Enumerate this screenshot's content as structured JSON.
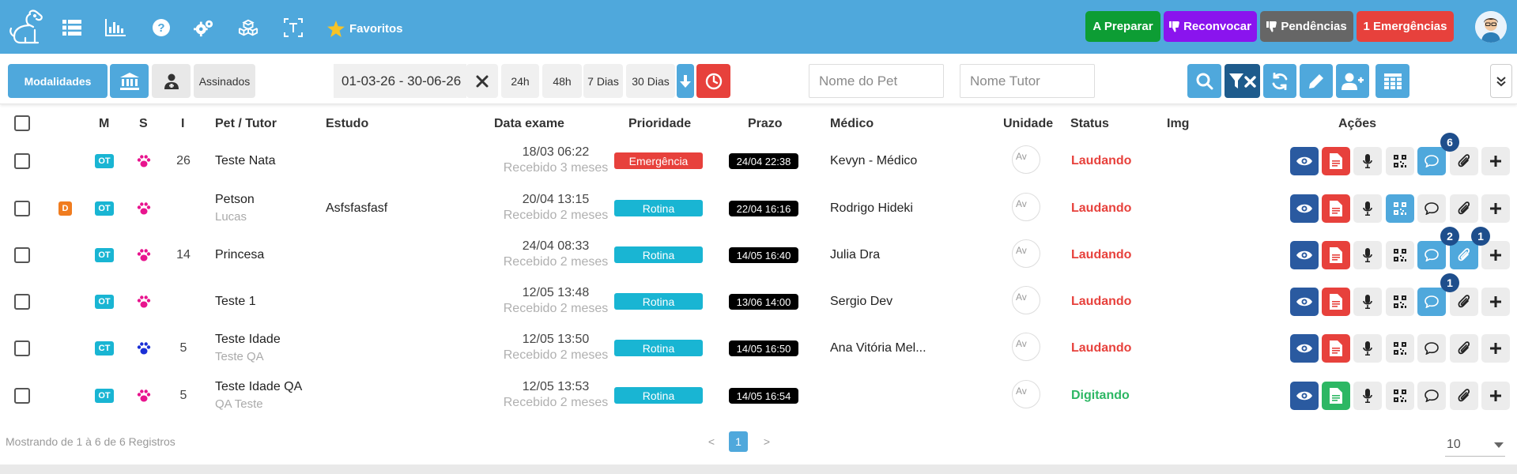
{
  "nav": {
    "favoritos_label": "Favoritos",
    "buttons": [
      {
        "label": "A Preparar",
        "color": "#0d9d34",
        "icon": ""
      },
      {
        "label": "Reconvocar",
        "color": "#8a14ee",
        "icon": "thumbs-down"
      },
      {
        "label": "Pendências",
        "color": "#666666",
        "icon": "thumbs-down"
      },
      {
        "label": "1 Emergências",
        "color": "#e7413c",
        "icon": ""
      }
    ]
  },
  "filters": {
    "modalidades_label": "Modalidades",
    "assinados_label": "Assinados",
    "date_range": "01-03-26 - 30-06-26",
    "quick_24h": "24h",
    "quick_48h": "48h",
    "quick_7d": "7 Dias",
    "quick_30d": "30 Dias",
    "pet_placeholder": "Nome do Pet",
    "tutor_placeholder": "Nome Tutor"
  },
  "table": {
    "headers": {
      "m": "M",
      "s": "S",
      "i": "I",
      "pet_tutor": "Pet / Tutor",
      "estudo": "Estudo",
      "data_exame": "Data exame",
      "prioridade": "Prioridade",
      "prazo": "Prazo",
      "medico": "Médico",
      "unidade": "Unidade",
      "status": "Status",
      "img": "Img",
      "acoes": "Ações"
    },
    "rows": [
      {
        "d": "",
        "mod": "OT",
        "mod_color": "#19b5d3",
        "paw_color": "#e8148e",
        "num": "26",
        "pet": "Teste Nata",
        "tutor": "",
        "estudo": "",
        "data": "18/03 06:22",
        "recebido": "Recebido 3 meses",
        "prioridade": "Emergência",
        "prio_color": "#e7413c",
        "prazo": "24/04 22:38",
        "medico": "Kevyn - Médico",
        "unidade_alt": "Av",
        "status": "Laudando",
        "status_color": "#e7413c",
        "comment_count": "6",
        "attach_count": ""
      },
      {
        "d": "D",
        "mod": "OT",
        "mod_color": "#19b5d3",
        "paw_color": "#e8148e",
        "num": "",
        "pet": "Petson",
        "tutor": "Lucas",
        "estudo": "Asfsfasfasf",
        "data": "20/04 13:15",
        "recebido": "Recebido 2 meses",
        "prioridade": "Rotina",
        "prio_color": "#19b5d3",
        "prazo": "22/04 16:16",
        "medico": "Rodrigo Hideki",
        "unidade_alt": "Av",
        "status": "Laudando",
        "status_color": "#e7413c",
        "comment_count": "",
        "attach_count": ""
      },
      {
        "d": "",
        "mod": "OT",
        "mod_color": "#19b5d3",
        "paw_color": "#e8148e",
        "num": "14",
        "pet": "Princesa",
        "tutor": "",
        "estudo": "",
        "data": "24/04 08:33",
        "recebido": "Recebido 2 meses",
        "prioridade": "Rotina",
        "prio_color": "#19b5d3",
        "prazo": "14/05 16:40",
        "medico": "Julia Dra",
        "unidade_alt": "Av",
        "status": "Laudando",
        "status_color": "#e7413c",
        "comment_count": "2",
        "attach_count": "1"
      },
      {
        "d": "",
        "mod": "OT",
        "mod_color": "#19b5d3",
        "paw_color": "#e8148e",
        "num": "",
        "pet": "Teste 1",
        "tutor": "",
        "estudo": "",
        "data": "12/05 13:48",
        "recebido": "Recebido 2 meses",
        "prioridade": "Rotina",
        "prio_color": "#19b5d3",
        "prazo": "13/06 14:00",
        "medico": "Sergio Dev",
        "unidade_alt": "Av",
        "status": "Laudando",
        "status_color": "#e7413c",
        "comment_count": "1",
        "attach_count": ""
      },
      {
        "d": "",
        "mod": "CT",
        "mod_color": "#19b5d3",
        "paw_color": "#1a2fd6",
        "num": "5",
        "pet": "Teste Idade",
        "tutor": "Teste QA",
        "estudo": "",
        "data": "12/05 13:50",
        "recebido": "Recebido 2 meses",
        "prioridade": "Rotina",
        "prio_color": "#19b5d3",
        "prazo": "14/05 16:50",
        "medico": "Ana Vitória Mel...",
        "unidade_alt": "Av",
        "status": "Laudando",
        "status_color": "#e7413c",
        "comment_count": "",
        "attach_count": ""
      },
      {
        "d": "",
        "mod": "OT",
        "mod_color": "#19b5d3",
        "paw_color": "#e8148e",
        "num": "5",
        "pet": "Teste Idade QA",
        "tutor": "QA Teste",
        "estudo": "",
        "data": "12/05 13:53",
        "recebido": "Recebido 2 meses",
        "prioridade": "Rotina",
        "prio_color": "#19b5d3",
        "prazo": "14/05 16:54",
        "medico": "",
        "unidade_alt": "Av",
        "status": "Digitando",
        "status_color": "#2db764",
        "comment_count": "",
        "attach_count": ""
      }
    ]
  },
  "footer": {
    "info": "Mostrando de 1 à 6 de 6 Registros",
    "prev": "<",
    "page": "1",
    "next": ">",
    "page_size": "10"
  }
}
